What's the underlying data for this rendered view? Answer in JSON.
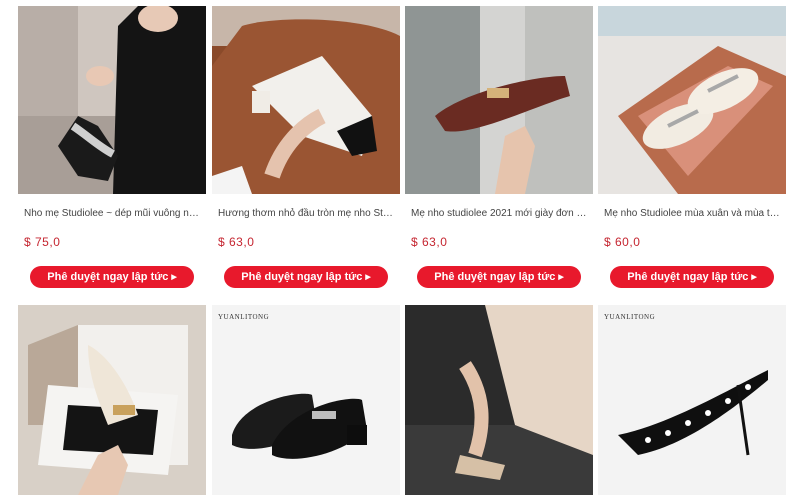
{
  "products_row1": [
    {
      "title": "Nho mẹ Studiolee ~ dép mũi vuông nữ từ ...",
      "price": "$ 75,0",
      "button": "Phê duyệt ngay lập tức"
    },
    {
      "title": "Hương thơm nhỏ đầu tròn mẹ nho Studiolee...",
      "price": "$ 63,0",
      "button": "Phê duyệt ngay lập tức"
    },
    {
      "title": "Mẹ nho studiolee 2021 mới giày đơn màu ...",
      "price": "$ 63,0",
      "button": "Phê duyệt ngay lập tức"
    },
    {
      "title": "Mẹ nho Studiolee mùa xuân và mùa thu lư...",
      "price": "$ 60,0",
      "button": "Phê duyệt ngay lập tức"
    }
  ],
  "brand_watermark": "YUANLITONG",
  "colors": {
    "accent": "#e8192c",
    "price": "#c52530"
  }
}
